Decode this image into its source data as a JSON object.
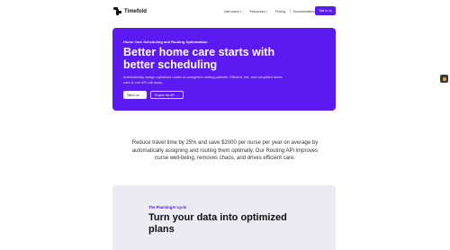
{
  "brand": {
    "name": "Timefold"
  },
  "nav": {
    "items": [
      {
        "label": "Use cases",
        "chevron": true
      },
      {
        "label": "Resources",
        "chevron": true
      },
      {
        "label": "Pricing",
        "chevron": false
      }
    ],
    "documentation_label": "Documentation",
    "cta_label": "Talk to us"
  },
  "hero": {
    "eyebrow": "Home Care Scheduling and Routing Optimization",
    "title": "Better home care starts with better scheduling",
    "subtitle": "Automatically assign optimized routes to caregivers visiting patients. Efficient, fair, and compliant home care is one API call away.",
    "primary_button": "Talk to us",
    "secondary_button": "Explore the API",
    "arrow": "→"
  },
  "description": "Reduce travel time by 25% and save $2000 per nurse per year on average by automatically assigning and routing them optimally. Our Routing API improves nurse well-being, removes chaos, and drives efficient care.",
  "planning": {
    "eyebrow": "The PlanningAI cycle",
    "title": "Turn your data into optimized plans"
  },
  "colors": {
    "accent": "#5a1af0",
    "card_bg": "#ebebf1",
    "text": "#1a1a1a"
  },
  "icons": {
    "logo": "timefold-logo-icon",
    "chevron": "chevron-down-icon",
    "external": "external-link-icon",
    "widget": "side-widget-icon"
  }
}
